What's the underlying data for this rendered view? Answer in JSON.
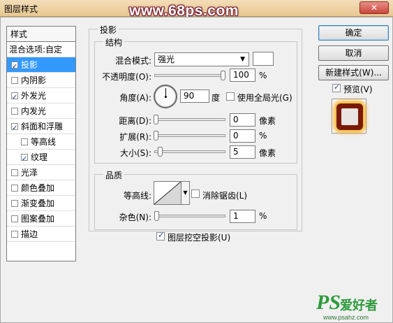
{
  "window": {
    "title": "图层样式",
    "close_label": "✕"
  },
  "watermarks": {
    "top": "www.68ps.com",
    "bottom_brand": "PS",
    "bottom_cn": "爱好者",
    "bottom_url": "www.psahz.com"
  },
  "style_list": {
    "header": "样式",
    "items": [
      {
        "label": "混合选项:自定",
        "checkbox": null,
        "indent": 0,
        "selected": false
      },
      {
        "label": "投影",
        "checkbox": true,
        "indent": 0,
        "selected": true
      },
      {
        "label": "内阴影",
        "checkbox": false,
        "indent": 0,
        "selected": false
      },
      {
        "label": "外发光",
        "checkbox": true,
        "indent": 0,
        "selected": false
      },
      {
        "label": "内发光",
        "checkbox": false,
        "indent": 0,
        "selected": false
      },
      {
        "label": "斜面和浮雕",
        "checkbox": true,
        "indent": 0,
        "selected": false
      },
      {
        "label": "等高线",
        "checkbox": false,
        "indent": 1,
        "selected": false
      },
      {
        "label": "纹理",
        "checkbox": true,
        "indent": 1,
        "selected": false
      },
      {
        "label": "光泽",
        "checkbox": false,
        "indent": 0,
        "selected": false
      },
      {
        "label": "颜色叠加",
        "checkbox": false,
        "indent": 0,
        "selected": false
      },
      {
        "label": "渐变叠加",
        "checkbox": false,
        "indent": 0,
        "selected": false
      },
      {
        "label": "图案叠加",
        "checkbox": false,
        "indent": 0,
        "selected": false
      },
      {
        "label": "描边",
        "checkbox": false,
        "indent": 0,
        "selected": false
      }
    ]
  },
  "panel": {
    "title": "投影",
    "structure": {
      "title": "结构",
      "blend_mode_label": "混合模式:",
      "blend_mode_value": "强光",
      "blend_color": "#ffffff",
      "opacity_label": "不透明度(O):",
      "opacity_value": "100",
      "opacity_unit": "%",
      "angle_label": "角度(A):",
      "angle_value": "90",
      "angle_unit": "度",
      "global_light_label": "使用全局光(G)",
      "global_light_checked": false,
      "distance_label": "距离(D):",
      "distance_value": "0",
      "distance_unit": "像素",
      "spread_label": "扩展(R):",
      "spread_value": "0",
      "spread_unit": "%",
      "size_label": "大小(S):",
      "size_value": "5",
      "size_unit": "像素"
    },
    "quality": {
      "title": "品质",
      "contour_label": "等高线:",
      "anti_alias_label": "消除锯齿(L)",
      "anti_alias_checked": false,
      "noise_label": "杂色(N):",
      "noise_value": "1",
      "noise_unit": "%"
    },
    "knockout_label": "图层挖空投影(U)",
    "knockout_checked": true
  },
  "buttons": {
    "ok": "确定",
    "cancel": "取消",
    "new_style": "新建样式(W)..."
  },
  "preview": {
    "label": "预览(V)",
    "checked": true
  },
  "colors": {
    "selection": "#3399ff",
    "title_bar": "#e8c891",
    "watermark_green": "#2c9a3a"
  }
}
